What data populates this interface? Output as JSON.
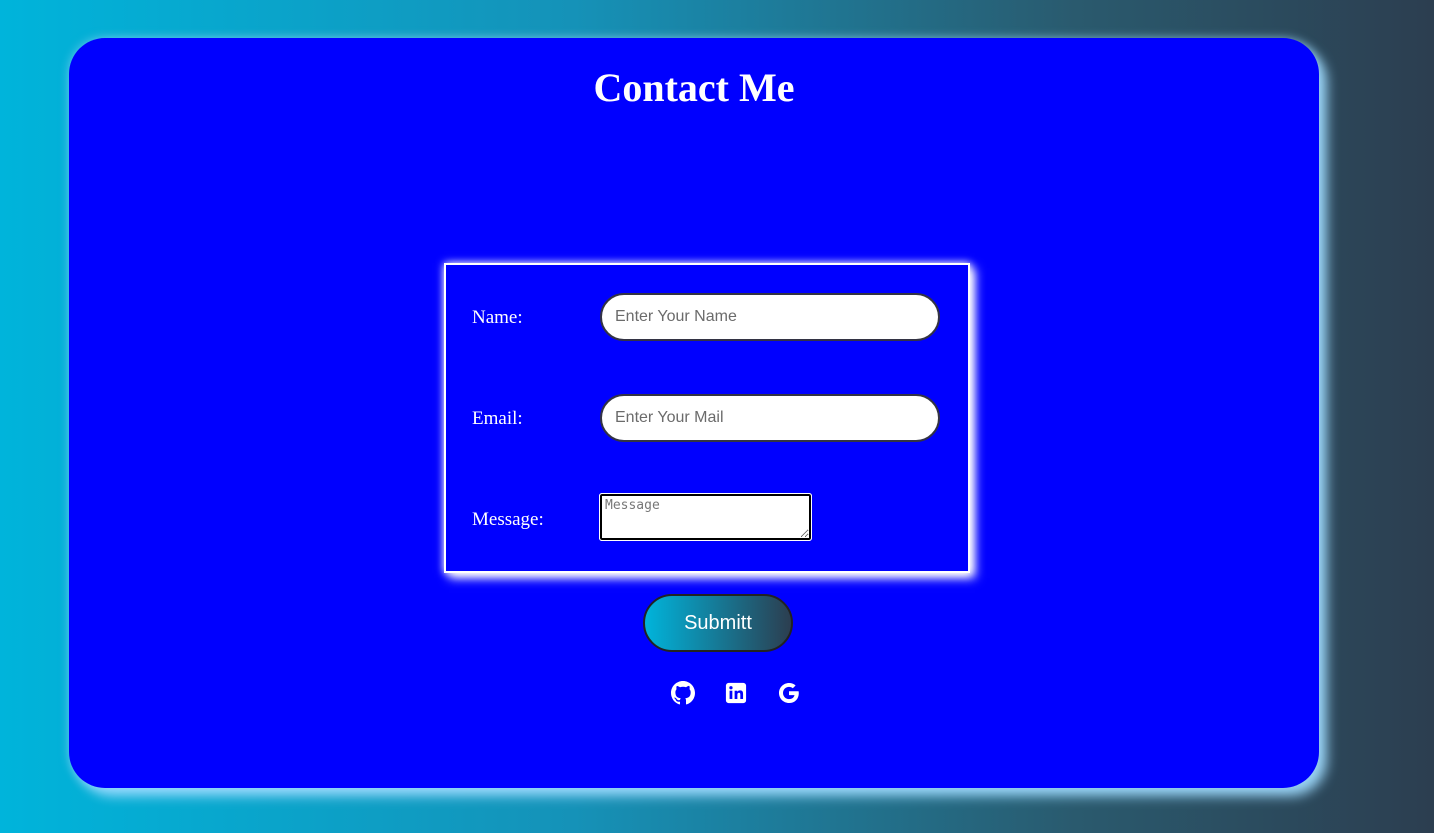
{
  "page": {
    "title": "Contact Me"
  },
  "form": {
    "name_label": "Name:",
    "name_placeholder": "Enter Your Name",
    "email_label": "Email:",
    "email_placeholder": "Enter Your Mail",
    "message_label": "Message:",
    "message_placeholder": "Message",
    "submit_label": "Submitt"
  },
  "social": [
    {
      "icon": "github-icon"
    },
    {
      "icon": "linkedin-icon"
    },
    {
      "icon": "google-icon"
    }
  ],
  "colors": {
    "card_background": "#0000ff",
    "text": "#ffffff",
    "gradient_start": "#00b4db",
    "gradient_end": "#2c3e50"
  }
}
